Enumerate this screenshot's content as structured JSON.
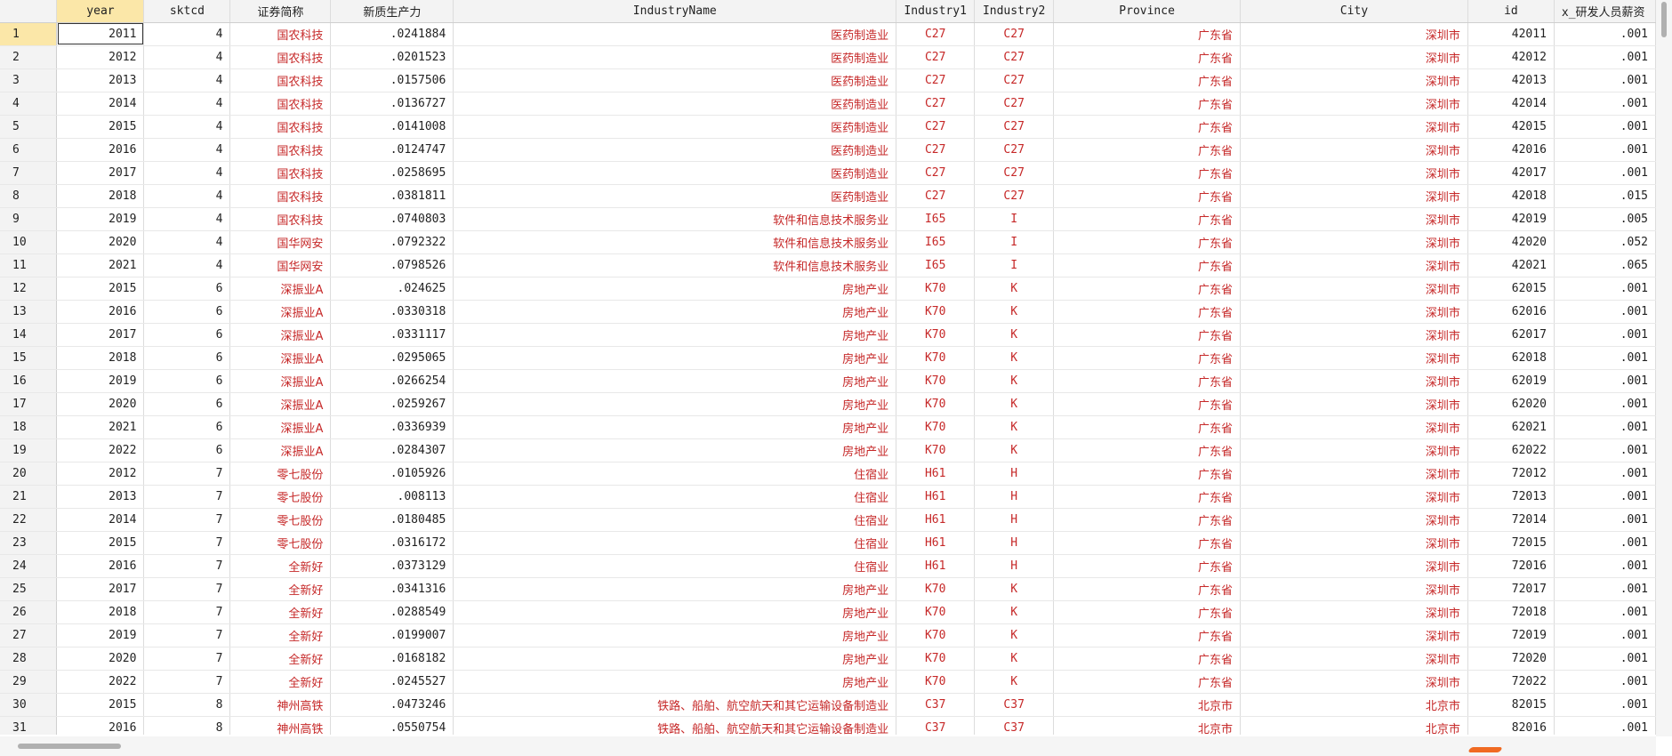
{
  "columns": [
    "year",
    "sktcd",
    "证券简称",
    "新质生产力",
    "IndustryName",
    "Industry1",
    "Industry2",
    "Province",
    "City",
    "id",
    "x_研发人员薪资"
  ],
  "rows": [
    [
      "1",
      "2011",
      "4",
      "国农科技",
      ".0241884",
      "医药制造业",
      "C27",
      "C27",
      "广东省",
      "深圳市",
      "42011",
      ".001"
    ],
    [
      "2",
      "2012",
      "4",
      "国农科技",
      ".0201523",
      "医药制造业",
      "C27",
      "C27",
      "广东省",
      "深圳市",
      "42012",
      ".001"
    ],
    [
      "3",
      "2013",
      "4",
      "国农科技",
      ".0157506",
      "医药制造业",
      "C27",
      "C27",
      "广东省",
      "深圳市",
      "42013",
      ".001"
    ],
    [
      "4",
      "2014",
      "4",
      "国农科技",
      ".0136727",
      "医药制造业",
      "C27",
      "C27",
      "广东省",
      "深圳市",
      "42014",
      ".001"
    ],
    [
      "5",
      "2015",
      "4",
      "国农科技",
      ".0141008",
      "医药制造业",
      "C27",
      "C27",
      "广东省",
      "深圳市",
      "42015",
      ".001"
    ],
    [
      "6",
      "2016",
      "4",
      "国农科技",
      ".0124747",
      "医药制造业",
      "C27",
      "C27",
      "广东省",
      "深圳市",
      "42016",
      ".001"
    ],
    [
      "7",
      "2017",
      "4",
      "国农科技",
      ".0258695",
      "医药制造业",
      "C27",
      "C27",
      "广东省",
      "深圳市",
      "42017",
      ".001"
    ],
    [
      "8",
      "2018",
      "4",
      "国农科技",
      ".0381811",
      "医药制造业",
      "C27",
      "C27",
      "广东省",
      "深圳市",
      "42018",
      ".015"
    ],
    [
      "9",
      "2019",
      "4",
      "国农科技",
      ".0740803",
      "软件和信息技术服务业",
      "I65",
      "I",
      "广东省",
      "深圳市",
      "42019",
      ".005"
    ],
    [
      "10",
      "2020",
      "4",
      "国华网安",
      ".0792322",
      "软件和信息技术服务业",
      "I65",
      "I",
      "广东省",
      "深圳市",
      "42020",
      ".052"
    ],
    [
      "11",
      "2021",
      "4",
      "国华网安",
      ".0798526",
      "软件和信息技术服务业",
      "I65",
      "I",
      "广东省",
      "深圳市",
      "42021",
      ".065"
    ],
    [
      "12",
      "2015",
      "6",
      "深振业A",
      ".024625",
      "房地产业",
      "K70",
      "K",
      "广东省",
      "深圳市",
      "62015",
      ".001"
    ],
    [
      "13",
      "2016",
      "6",
      "深振业A",
      ".0330318",
      "房地产业",
      "K70",
      "K",
      "广东省",
      "深圳市",
      "62016",
      ".001"
    ],
    [
      "14",
      "2017",
      "6",
      "深振业A",
      ".0331117",
      "房地产业",
      "K70",
      "K",
      "广东省",
      "深圳市",
      "62017",
      ".001"
    ],
    [
      "15",
      "2018",
      "6",
      "深振业A",
      ".0295065",
      "房地产业",
      "K70",
      "K",
      "广东省",
      "深圳市",
      "62018",
      ".001"
    ],
    [
      "16",
      "2019",
      "6",
      "深振业A",
      ".0266254",
      "房地产业",
      "K70",
      "K",
      "广东省",
      "深圳市",
      "62019",
      ".001"
    ],
    [
      "17",
      "2020",
      "6",
      "深振业A",
      ".0259267",
      "房地产业",
      "K70",
      "K",
      "广东省",
      "深圳市",
      "62020",
      ".001"
    ],
    [
      "18",
      "2021",
      "6",
      "深振业A",
      ".0336939",
      "房地产业",
      "K70",
      "K",
      "广东省",
      "深圳市",
      "62021",
      ".001"
    ],
    [
      "19",
      "2022",
      "6",
      "深振业A",
      ".0284307",
      "房地产业",
      "K70",
      "K",
      "广东省",
      "深圳市",
      "62022",
      ".001"
    ],
    [
      "20",
      "2012",
      "7",
      "零七股份",
      ".0105926",
      "住宿业",
      "H61",
      "H",
      "广东省",
      "深圳市",
      "72012",
      ".001"
    ],
    [
      "21",
      "2013",
      "7",
      "零七股份",
      ".008113",
      "住宿业",
      "H61",
      "H",
      "广东省",
      "深圳市",
      "72013",
      ".001"
    ],
    [
      "22",
      "2014",
      "7",
      "零七股份",
      ".0180485",
      "住宿业",
      "H61",
      "H",
      "广东省",
      "深圳市",
      "72014",
      ".001"
    ],
    [
      "23",
      "2015",
      "7",
      "零七股份",
      ".0316172",
      "住宿业",
      "H61",
      "H",
      "广东省",
      "深圳市",
      "72015",
      ".001"
    ],
    [
      "24",
      "2016",
      "7",
      "全新好",
      ".0373129",
      "住宿业",
      "H61",
      "H",
      "广东省",
      "深圳市",
      "72016",
      ".001"
    ],
    [
      "25",
      "2017",
      "7",
      "全新好",
      ".0341316",
      "房地产业",
      "K70",
      "K",
      "广东省",
      "深圳市",
      "72017",
      ".001"
    ],
    [
      "26",
      "2018",
      "7",
      "全新好",
      ".0288549",
      "房地产业",
      "K70",
      "K",
      "广东省",
      "深圳市",
      "72018",
      ".001"
    ],
    [
      "27",
      "2019",
      "7",
      "全新好",
      ".0199007",
      "房地产业",
      "K70",
      "K",
      "广东省",
      "深圳市",
      "72019",
      ".001"
    ],
    [
      "28",
      "2020",
      "7",
      "全新好",
      ".0168182",
      "房地产业",
      "K70",
      "K",
      "广东省",
      "深圳市",
      "72020",
      ".001"
    ],
    [
      "29",
      "2022",
      "7",
      "全新好",
      ".0245527",
      "房地产业",
      "K70",
      "K",
      "广东省",
      "深圳市",
      "72022",
      ".001"
    ],
    [
      "30",
      "2015",
      "8",
      "神州高铁",
      ".0473246",
      "铁路、船舶、航空航天和其它运输设备制造业",
      "C37",
      "C37",
      "北京市",
      "北京市",
      "82015",
      ".001"
    ],
    [
      "31",
      "2016",
      "8",
      "神州高铁",
      ".0550754",
      "铁路、船舶、航空航天和其它运输设备制造业",
      "C37",
      "C37",
      "北京市",
      "北京市",
      "82016",
      ".001"
    ]
  ],
  "selection": {
    "row": 1,
    "column": "year"
  },
  "colors": {
    "string_cell": "#c62828",
    "selected_header": "#fbe7a8",
    "scroll_marker": "#f06a22"
  }
}
